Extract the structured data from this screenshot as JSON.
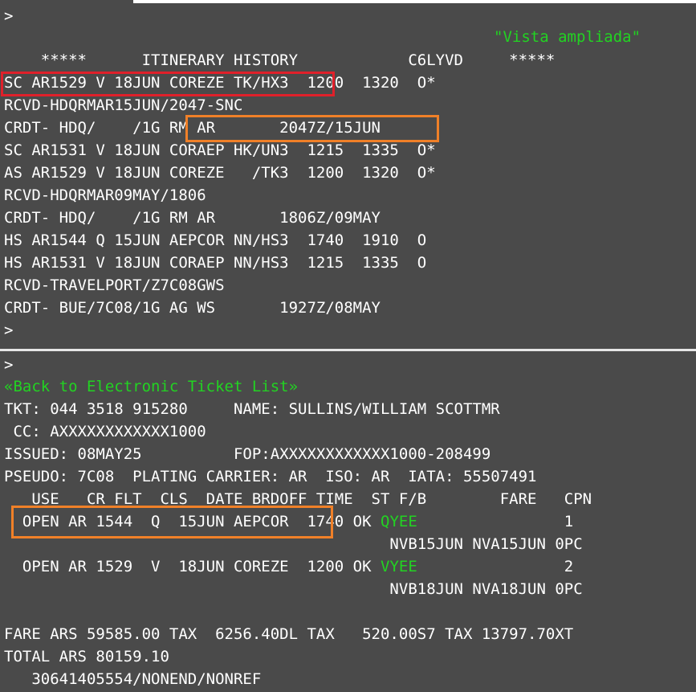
{
  "colors": {
    "background": "#4a4a4a",
    "text": "#ffffff",
    "green": "#22d322",
    "red_box": "#e0202a",
    "orange_box": "#f08028"
  },
  "top": {
    "prompt1": ">",
    "vista": "\"Vista ampliada\"",
    "header": "    *****      ITINERARY HISTORY            C6LYVD     *****",
    "lines": [
      "SC AR1529 V 18JUN COREZE TK/HX3  1200  1320  O*",
      "RCVD-HDQRMAR15JUN/2047-SNC",
      "CRDT- HDQ/    /1G RM AR       2047Z/15JUN",
      "SC AR1531 V 18JUN CORAEP HK/UN3  1215  1335  O*",
      "AS AR1529 V 18JUN COREZE   /TK3  1200  1320  O*",
      "RCVD-HDQRMAR09MAY/1806",
      "CRDT- HDQ/    /1G RM AR       1806Z/09MAY",
      "HS AR1544 Q 15JUN AEPCOR NN/HS3  1740  1910  O",
      "HS AR1531 V 18JUN CORAEP NN/HS3  1215  1335  O",
      "RCVD-TRAVELPORT/Z7C08GWS",
      "CRDT- BUE/7C08/1G AG WS       1927Z/08MAY"
    ],
    "prompt2": ">"
  },
  "bottom": {
    "prompt": ">",
    "back_link": "«Back to Electronic Ticket List»",
    "lines": [
      "TKT: 044 3518 915280     NAME: SULLINS/WILLIAM SCOTTMR",
      " CC: AXXXXXXXXXXXX1000",
      "ISSUED: 08MAY25          FOP:AXXXXXXXXXXXX1000-208499",
      "PSEUDO: 7C08  PLATING CARRIER: AR  ISO: AR  IATA: 55507491",
      "   USE   CR FLT  CLS  DATE BRDOFF TIME  ST F/B        FARE   CPN"
    ],
    "coupons": [
      {
        "prefix": "  OPEN AR 1544  Q  15JUN AEPCOR  1740 OK ",
        "fb": "QYEE",
        "suffix": "                1",
        "second": "                                          NVB15JUN NVA15JUN 0PC"
      },
      {
        "prefix": "  OPEN AR 1529  V  18JUN COREZE  1200 OK ",
        "fb": "VYEE",
        "suffix": "                2",
        "second": "                                          NVB18JUN NVA18JUN 0PC"
      }
    ],
    "fare_line": "FARE ARS 59585.00 TAX  6256.40DL TAX   520.00S7 TAX 13797.70XT",
    "total_line": "TOTAL ARS 80159.10",
    "endorse_line": "   30641405554/NONEND/NONREF"
  }
}
